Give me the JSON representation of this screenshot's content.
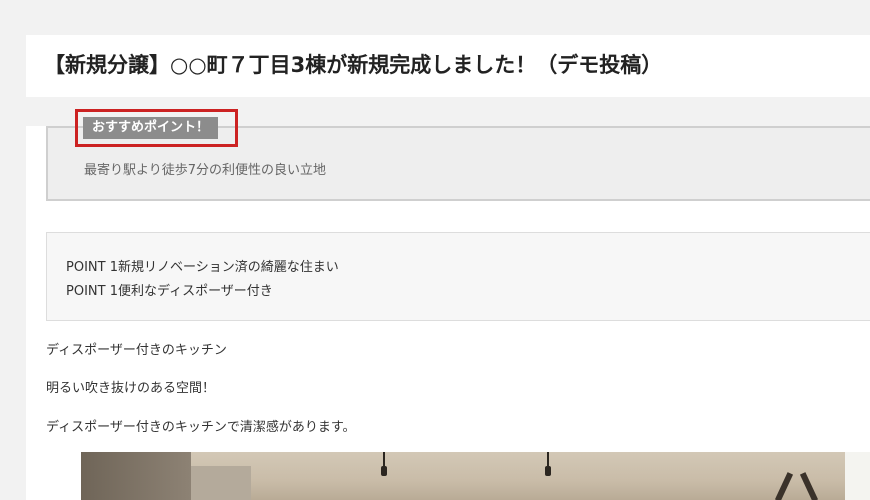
{
  "post": {
    "title": "【新規分譲】○○町７丁目3棟が新規完成しました！（デモ投稿）"
  },
  "recommend": {
    "label": "おすすめポイント！",
    "text": "最寄り駅より徒歩7分の利便性の良い立地"
  },
  "points": [
    "POINT 1新規リノベーション済の綺麗な住まい",
    "POINT 1便利なディスポーザー付き"
  ],
  "paragraphs": [
    "ディスポーザー付きのキッチン",
    "明るい吹き抜けのある空間！",
    "ディスポーザー付きのキッチンで清潔感があります。"
  ]
}
